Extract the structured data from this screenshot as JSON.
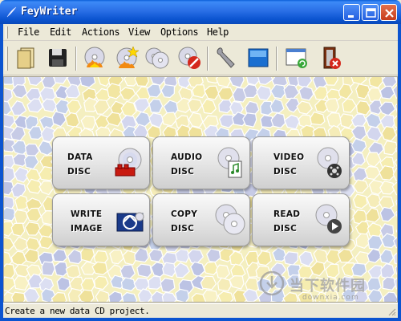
{
  "window": {
    "title": "FeyWriter",
    "controls": [
      "minimize",
      "maximize",
      "close"
    ]
  },
  "menu": {
    "items": [
      "File",
      "Edit",
      "Actions",
      "View",
      "Options",
      "Help"
    ]
  },
  "toolbar": {
    "icons": [
      "new-project-icon",
      "save-icon",
      "burn-disc-icon",
      "burn-star-icon",
      "copy-disc-icon",
      "erase-disc-icon",
      "settings-wrench-icon",
      "fullscreen-icon",
      "refresh-window-icon",
      "exit-icon"
    ]
  },
  "cards": [
    {
      "line1": "DATA",
      "line2": "DISC",
      "icon": "data-disc-icon"
    },
    {
      "line1": "AUDIO",
      "line2": "DISC",
      "icon": "audio-disc-icon"
    },
    {
      "line1": "VIDEO",
      "line2": "DISC",
      "icon": "video-disc-icon"
    },
    {
      "line1": "WRITE",
      "line2": "IMAGE",
      "icon": "write-image-icon"
    },
    {
      "line1": "COPY",
      "line2": "DISC",
      "icon": "copy-disc-icon"
    },
    {
      "line1": "READ",
      "line2": "DISC",
      "icon": "read-disc-icon"
    }
  ],
  "watermark": {
    "text": "当下软件园",
    "url": "downxia.com"
  },
  "status": {
    "text": "Create a new data CD project."
  },
  "colors": {
    "titlebar": "#0b54d0",
    "chrome": "#ece9d8",
    "background": "#f4efc0",
    "mosaic_blue": "#c8cde8",
    "mosaic_yellow": "#f3eaa8"
  }
}
